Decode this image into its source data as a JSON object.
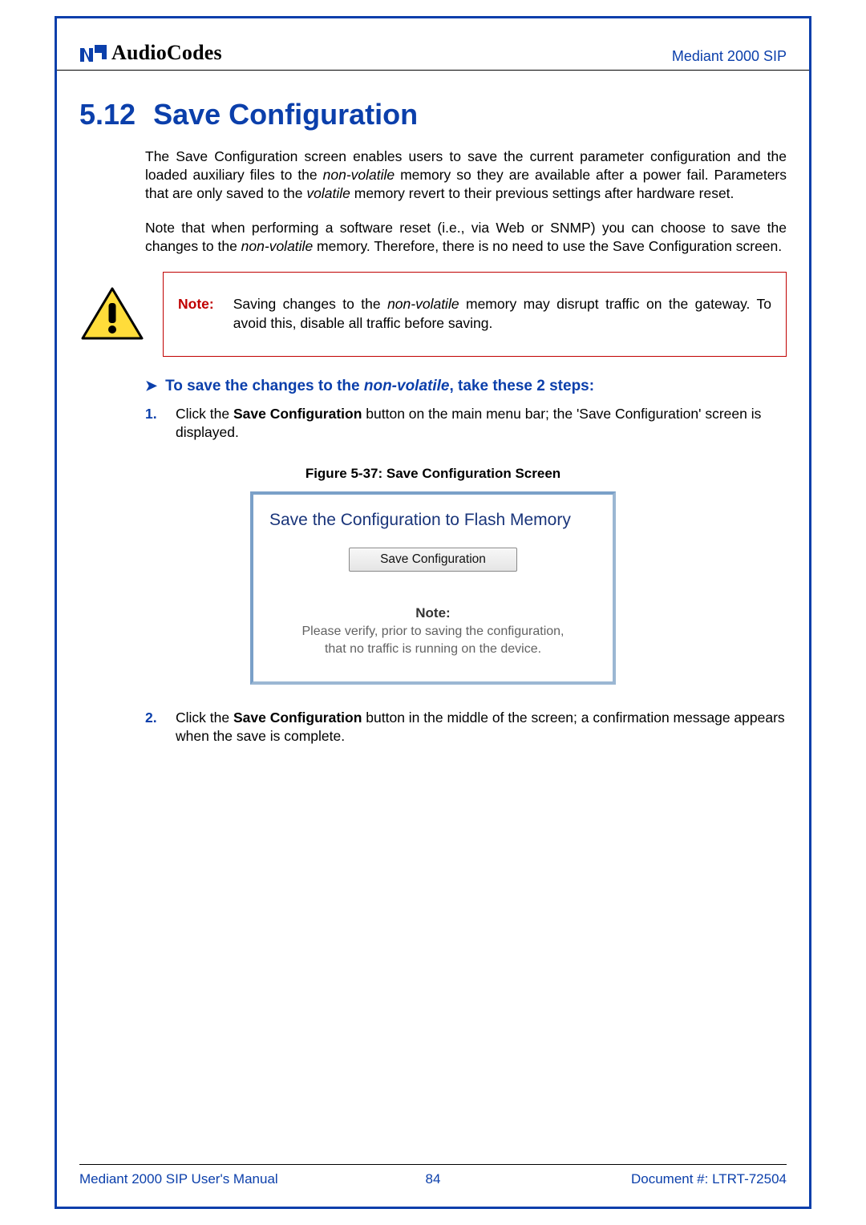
{
  "header": {
    "logo_text": "AudioCodes",
    "right": "Mediant 2000 SIP"
  },
  "section": {
    "number": "5.12",
    "title": "Save Configuration"
  },
  "paragraphs": {
    "p1_a": "The Save Configuration screen enables users to save the current parameter configuration and the loaded auxiliary files to the ",
    "p1_em1": "non-volatile",
    "p1_b": " memory so they are available after a power fail. Parameters that are only saved to the ",
    "p1_em2": "volatile",
    "p1_c": " memory revert to their previous settings after hardware reset.",
    "p2_a": "Note that when performing a software reset (i.e., via Web or SNMP) you can choose to save the changes to the ",
    "p2_em1": "non-volatile",
    "p2_b": " memory. Therefore, there is no need to use the Save Configuration screen."
  },
  "note_box": {
    "label": "Note:",
    "text_a": "Saving changes to the ",
    "text_em": "non-volatile",
    "text_b": " memory may disrupt traffic on the gateway. To avoid this, disable all traffic before saving."
  },
  "procedure": {
    "heading_a": "To save the changes to the ",
    "heading_em": "non-volatile",
    "heading_b": ", take these 2 steps:"
  },
  "steps": {
    "s1_num": "1.",
    "s1_a": "Click the ",
    "s1_strong": "Save Configuration",
    "s1_b": " button on the main menu bar; the 'Save Configuration' screen is displayed.",
    "s2_num": "2.",
    "s2_a": "Click the ",
    "s2_strong": "Save Configuration",
    "s2_b": " button in the middle of the screen; a confirmation message appears when the save is complete."
  },
  "figure": {
    "caption": "Figure 5-37: Save Configuration Screen"
  },
  "screenshot": {
    "title": "Save the Configuration to Flash Memory",
    "button_label": "Save Configuration",
    "note_label": "Note:",
    "note_line1": "Please verify, prior to saving the configuration,",
    "note_line2": "that no traffic is running on the device."
  },
  "footer": {
    "left": "Mediant 2000 SIP User's Manual",
    "center": "84",
    "right": "Document #: LTRT-72504"
  }
}
